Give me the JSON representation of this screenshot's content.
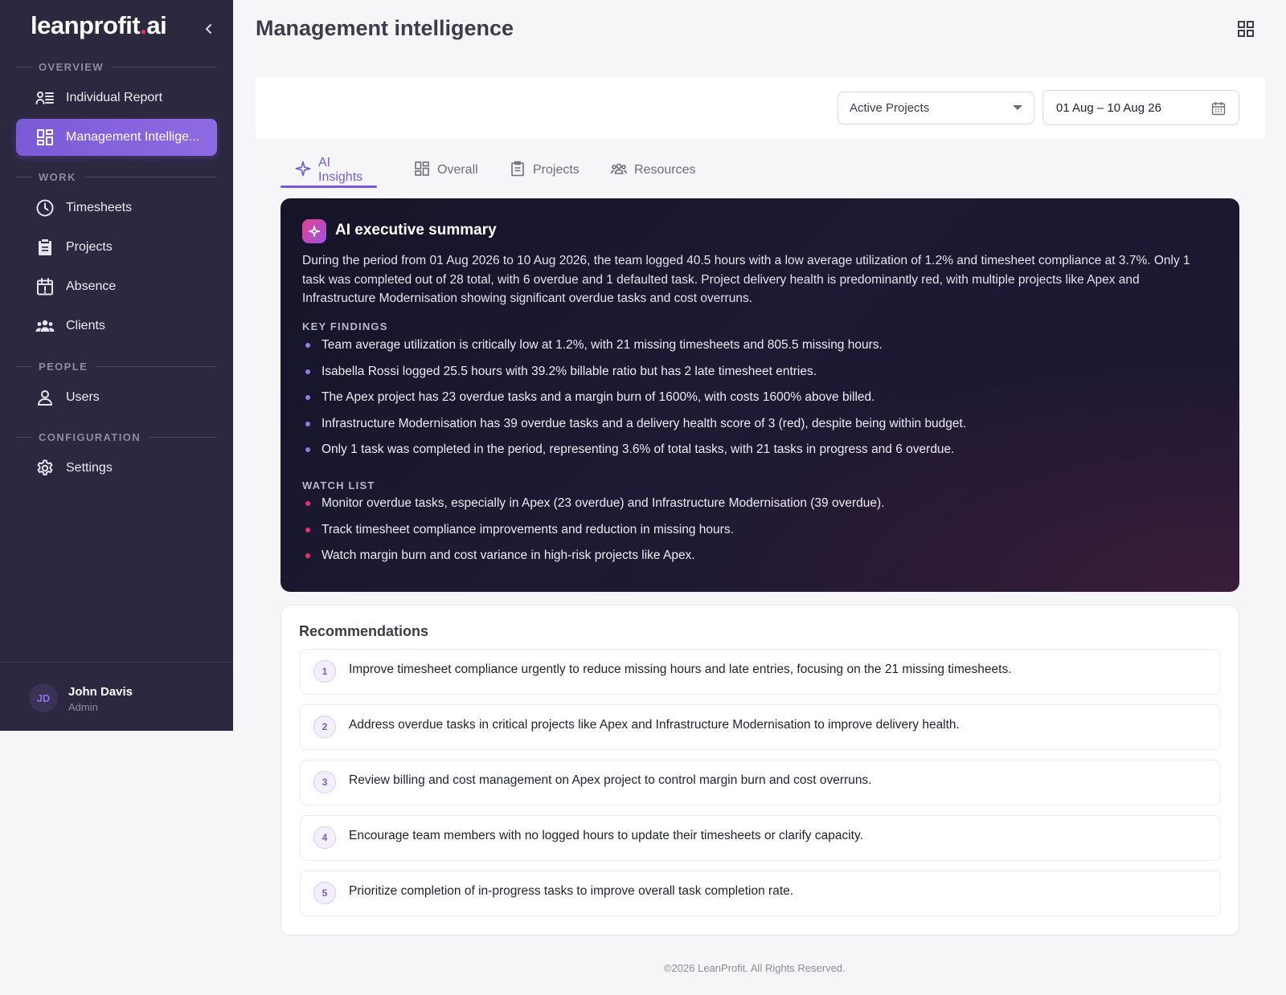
{
  "brand": {
    "name": "leanprofit",
    "dot": ".",
    "tld": "ai"
  },
  "sidebar": {
    "sections": {
      "overview": "OVERVIEW",
      "work": "WORK",
      "people": "PEOPLE",
      "configuration": "CONFIGURATION"
    },
    "items": {
      "individual_report": "Individual Report",
      "management_intelligence": "Management Intellige...",
      "timesheets": "Timesheets",
      "projects": "Projects",
      "absence": "Absence",
      "clients": "Clients",
      "users": "Users",
      "settings": "Settings"
    },
    "user": {
      "initials": "JD",
      "name": "John Davis",
      "role": "Admin"
    }
  },
  "header": {
    "title": "Management intelligence"
  },
  "filters": {
    "project_select": "Active Projects",
    "date_range": "01 Aug – 10 Aug 26"
  },
  "tabs": {
    "ai_insights": "AI Insights",
    "overall": "Overall",
    "projects": "Projects",
    "resources": "Resources"
  },
  "ai_summary": {
    "title": "AI executive summary",
    "summary": "During the period from 01 Aug 2026 to 10 Aug 2026, the team logged 40.5 hours with a low average utilization of 1.2% and timesheet compliance at 3.7%. Only 1 task was completed out of 28 total, with 6 overdue and 1 defaulted task. Project delivery health is predominantly red, with multiple projects like Apex and Infrastructure Modernisation showing significant overdue tasks and cost overruns.",
    "key_findings_label": "KEY FINDINGS",
    "key_findings": [
      "Team average utilization is critically low at 1.2%, with 21 missing timesheets and 805.5 missing hours.",
      "Isabella Rossi logged 25.5 hours with 39.2% billable ratio but has 2 late timesheet entries.",
      "The Apex project has 23 overdue tasks and a margin burn of 1600%, with costs 1600% above billed.",
      "Infrastructure Modernisation has 39 overdue tasks and a delivery health score of 3 (red), despite being within budget.",
      "Only 1 task was completed in the period, representing 3.6% of total tasks, with 21 tasks in progress and 6 overdue."
    ],
    "watch_list_label": "WATCH LIST",
    "watch_list": [
      "Monitor overdue tasks, especially in Apex (23 overdue) and Infrastructure Modernisation (39 overdue).",
      "Track timesheet compliance improvements and reduction in missing hours.",
      "Watch margin burn and cost variance in high-risk projects like Apex."
    ]
  },
  "recommendations": {
    "title": "Recommendations",
    "items": [
      {
        "num": "1",
        "text": "Improve timesheet compliance urgently to reduce missing hours and late entries, focusing on the 21 missing timesheets."
      },
      {
        "num": "2",
        "text": "Address overdue tasks in critical projects like Apex and Infrastructure Modernisation to improve delivery health."
      },
      {
        "num": "3",
        "text": "Review billing and cost management on Apex project to control margin burn and cost overruns."
      },
      {
        "num": "4",
        "text": "Encourage team members with no logged hours to update their timesheets or clarify capacity."
      },
      {
        "num": "5",
        "text": "Prioritize completion of in-progress tasks to improve overall task completion rate."
      }
    ]
  },
  "footer": {
    "copyright": "©2026 LeanProfit. All Rights Reserved."
  },
  "colors": {
    "sidebar_bg": "#2b2840",
    "accent": "#7a5bd6",
    "brand_dot": "#e8336f",
    "ai_card_bg": "#1a1730",
    "finding_bullet": "#9a7be8",
    "watch_bullet": "#e8336f"
  },
  "icons": {
    "collapse": "chevron-left-icon",
    "grid": "grid-icon",
    "calendar": "calendar-icon",
    "sparkle": "sparkle-icon"
  }
}
